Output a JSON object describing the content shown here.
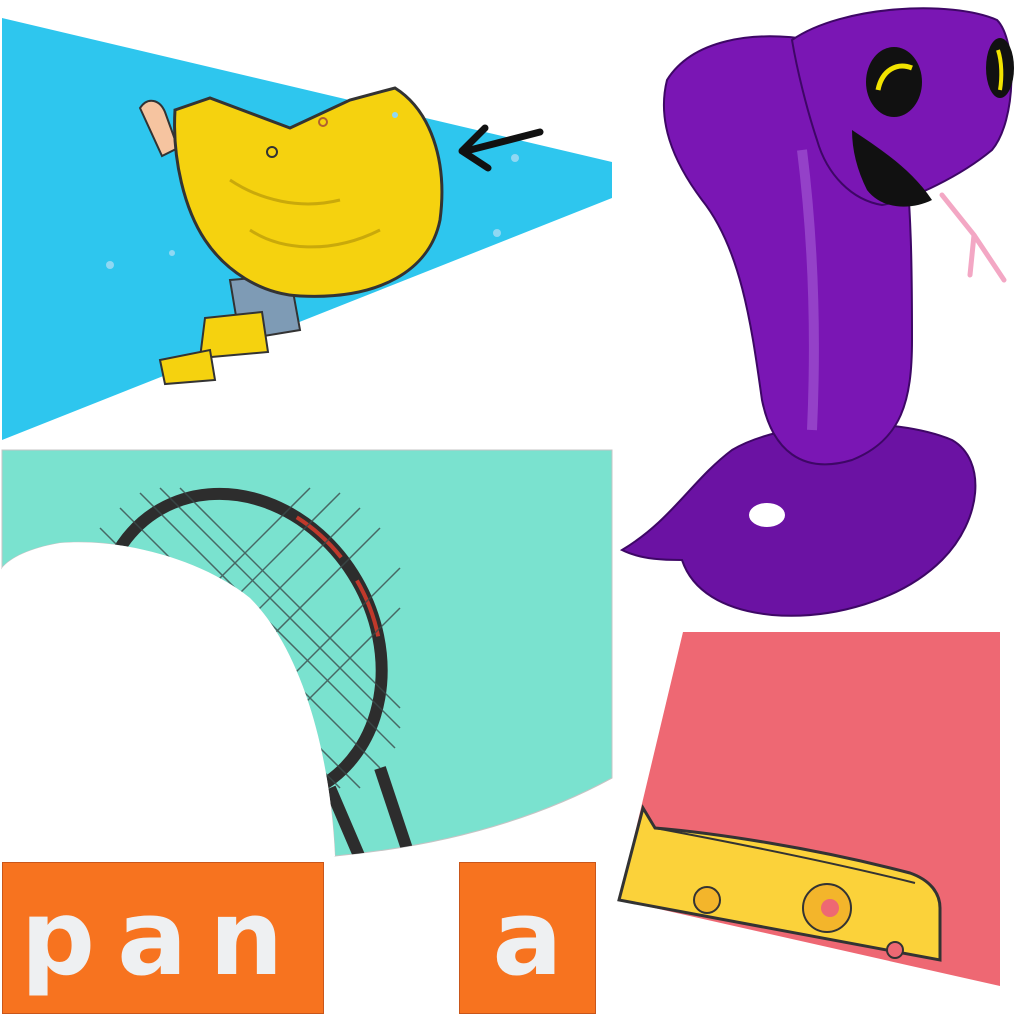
{
  "colors": {
    "raincoat_background": "#2ec6ee",
    "raincoat_yellow": "#f5d20f",
    "tennis_background": "#7ae2cf",
    "cheese_background": "#ee6873",
    "cheese_yellow": "#fbd23a",
    "snake_purple": "#7a16b4",
    "tile_orange": "#f7731f",
    "tile_text": "#eef0f2"
  },
  "picture_pieces": [
    {
      "name": "raincoat-piece",
      "icon": "raincoat-child-icon"
    },
    {
      "name": "snake-piece",
      "icon": "cobra-snake-icon"
    },
    {
      "name": "tennis-racket-piece",
      "icon": "tennis-racket-icon"
    },
    {
      "name": "cheese-piece",
      "icon": "cheese-wedge-icon"
    }
  ],
  "word_tiles": [
    {
      "label": "pan"
    },
    {
      "label": "a"
    }
  ]
}
